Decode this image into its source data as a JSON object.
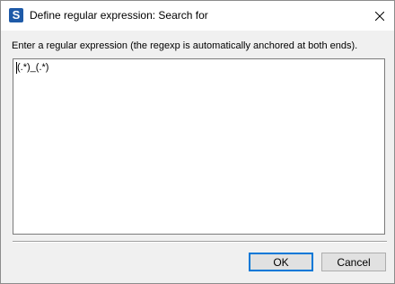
{
  "window": {
    "title": "Define regular expression: Search for",
    "app_icon_letter": "S",
    "app_icon_color": "#1e5aa8"
  },
  "dialog": {
    "prompt": "Enter a regular expression (the regexp is automatically anchored at both ends).",
    "regex_value": "(.*)_(.*)"
  },
  "buttons": {
    "ok_label": "OK",
    "cancel_label": "Cancel"
  },
  "icons": {
    "close": "close-icon",
    "app": "app-icon"
  },
  "colors": {
    "focus_border": "#0078d7",
    "dialog_background": "#f0f0f0"
  }
}
